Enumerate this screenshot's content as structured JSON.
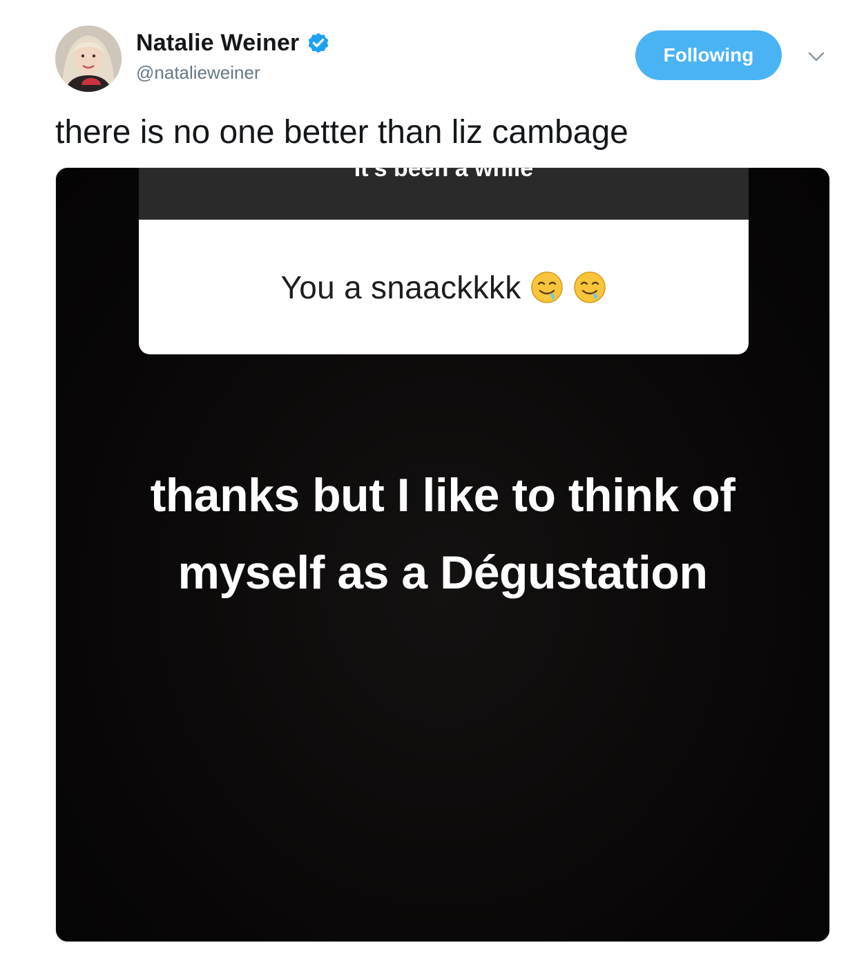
{
  "tweet": {
    "author": {
      "display_name": "Natalie Weiner",
      "handle": "@natalieweiner",
      "verified": true
    },
    "follow_button_label": "Following",
    "text": "there is no one better than liz cambage"
  },
  "media": {
    "question_prompt": "It's been a while",
    "answer": "You a snaackkkk",
    "answer_emojis": [
      "drooling-face-icon",
      "drooling-face-icon"
    ],
    "reply_line_1": "thanks but I like to think of",
    "reply_line_2": "myself as a Dégustation"
  },
  "colors": {
    "follow_button": "#4ab3f4",
    "verified_badge": "#1da1f2",
    "text_primary": "#14171a",
    "text_secondary": "#657786"
  }
}
